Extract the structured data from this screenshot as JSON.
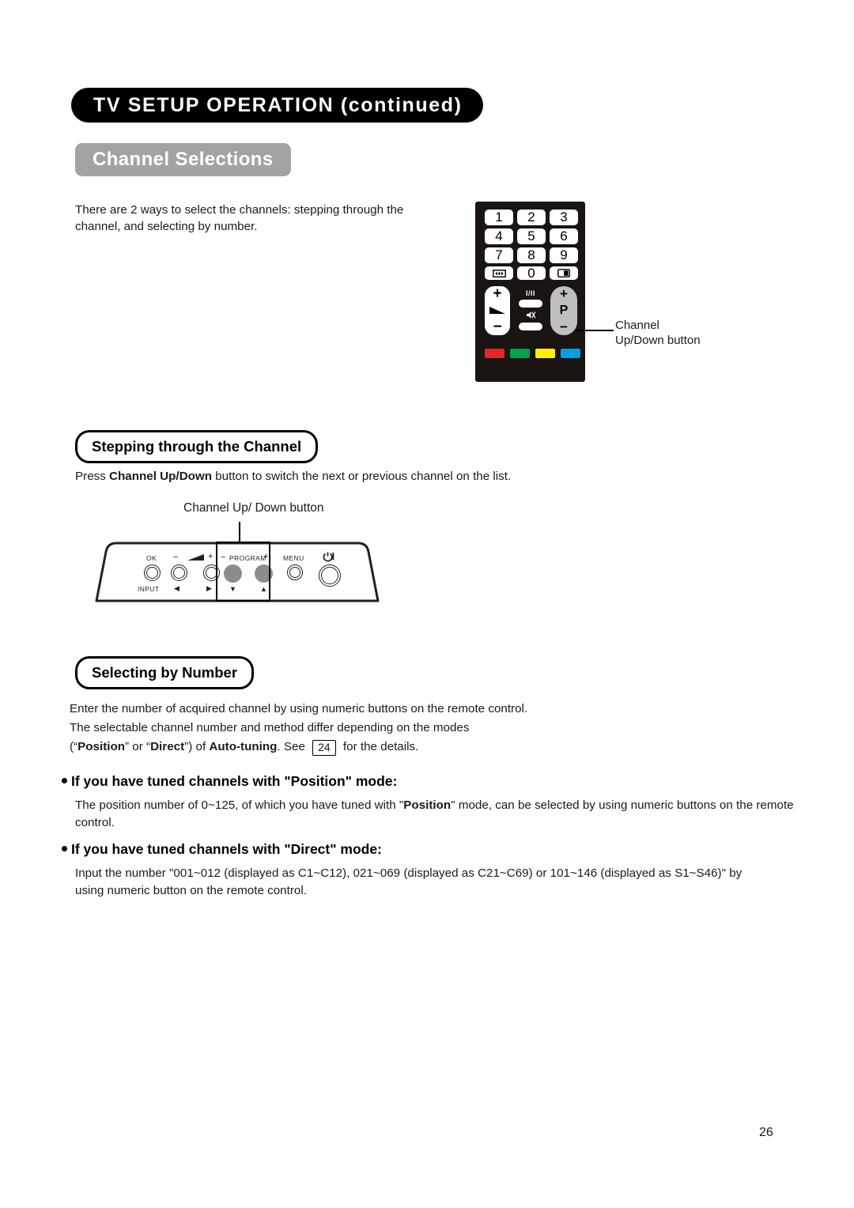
{
  "header": {
    "title": "TV SETUP OPERATION (continued)",
    "section_title": "Channel Selections"
  },
  "intro": {
    "text": "There are 2 ways to select the channels: stepping through the channel, and selecting by number."
  },
  "remote": {
    "keys": [
      "1",
      "2",
      "3",
      "4",
      "5",
      "6",
      "7",
      "8",
      "9"
    ],
    "zero_key": "0",
    "wide_icon": "widescreen-icon",
    "picture_icon": "picture-mode-icon",
    "volume_plus": "+",
    "volume_minus": "−",
    "volume_icon": "volume-wedge-icon",
    "sound_mode_label": "I/II",
    "mute_icon": "mute-icon",
    "program_plus": "+",
    "program_letter": "P",
    "program_minus": "−",
    "color_keys": [
      {
        "name": "red",
        "color": "#e8252a"
      },
      {
        "name": "green",
        "color": "#00a14b"
      },
      {
        "name": "yellow",
        "color": "#fff200"
      },
      {
        "name": "blue",
        "color": "#00a0e4"
      }
    ],
    "callout_line1": "Channel",
    "callout_line2": "Up/Down button"
  },
  "stepping": {
    "heading": "Stepping through the Channel",
    "body_before": "Press ",
    "body_bold": "Channel Up/Down",
    "body_after": " button to switch the next or previous channel on the list."
  },
  "panel": {
    "callout": "Channel Up/ Down button",
    "ok_label": "OK",
    "input_label": "INPUT",
    "vol_minus": "−",
    "vol_plus": "+",
    "left_arrow": "◀",
    "right_arrow": "▶",
    "program_minus": "−",
    "program_label": "PROGRAM",
    "program_plus": "+",
    "down_arrow": "▼",
    "up_arrow": "▲",
    "menu_label": "MENU",
    "power_icon": "power-icon"
  },
  "selecting": {
    "heading": "Selecting by Number",
    "line1": "Enter the number of acquired channel by using numeric buttons on the remote control.",
    "line2": "The selectable channel number and method differ depending on the modes",
    "line3_a": "(“",
    "line3_position": "Position",
    "line3_b": "” or “",
    "line3_direct": "Direct",
    "line3_c": "”) of ",
    "line3_autotuning": "Auto-tuning",
    "line3_d": ". See ",
    "page_ref": "24",
    "line3_e": " for the details."
  },
  "position_mode": {
    "heading": "If you have tuned channels with \"Position\" mode:",
    "body_a": "The position number of 0~125, of which you have tuned with \"",
    "body_bold": "Position",
    "body_b": "\" mode, can be selected by using numeric buttons on the remote control."
  },
  "direct_mode": {
    "heading": "If you have tuned channels with \"Direct\" mode:",
    "body": "Input the number \"001~012 (displayed as C1~C12), 021~069 (displayed as C21~C69) or 101~146 (displayed as S1~S46)\" by using numeric button on the remote control."
  },
  "footer": {
    "page_number": "26"
  }
}
